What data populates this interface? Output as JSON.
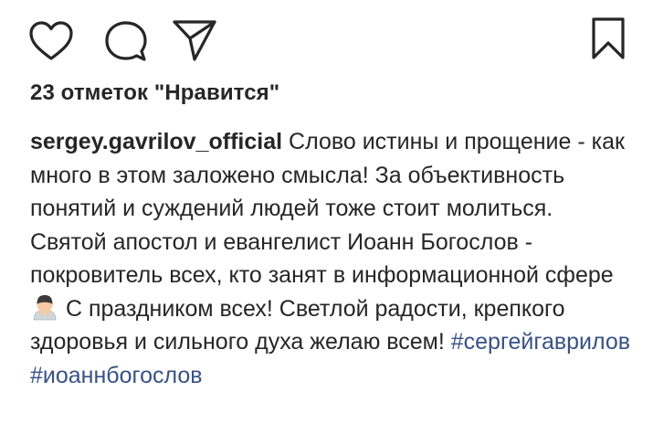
{
  "actions": {
    "like_icon": "heart-outline-icon",
    "comment_icon": "speech-bubble-icon",
    "share_icon": "paper-plane-icon",
    "save_icon": "bookmark-outline-icon"
  },
  "likes_text": "23 отметок \"Нравится\"",
  "caption": {
    "username": "sergey.gavrilov_official",
    "text_part1": "Слово истины и прощение - как много в этом заложено смысла! За объективность понятий и суждений людей тоже стоит молиться. Святой апостол и евангелист Иоанн Богослов - покровитель всех, кто занят в информационной сфере",
    "emoji": "🙇‍♂️",
    "text_part2": "С праздником всех! Светлой радости, крепкого здоровья и сильного духа желаю всем!",
    "hashtags": [
      "#сергейгаврилов",
      "#иоаннбогослов"
    ]
  },
  "colors": {
    "text": "#262626",
    "hashtag": "#385185",
    "background": "#ffffff"
  }
}
